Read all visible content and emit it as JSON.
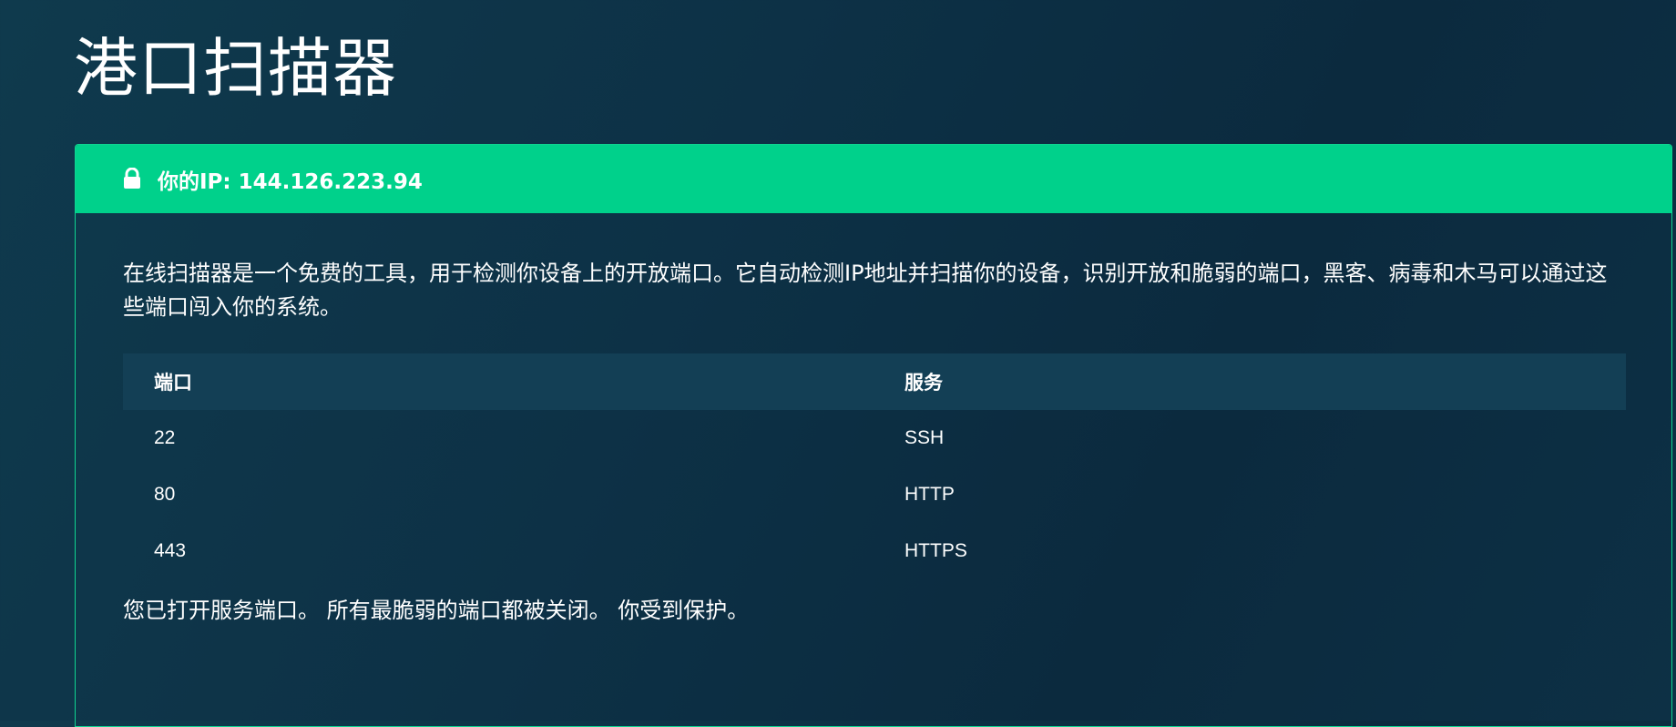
{
  "page": {
    "title": "港口扫描器"
  },
  "card": {
    "header": {
      "icon": "lock-icon",
      "ip_text": "你的IP: 144.126.223.94"
    },
    "description": "在线扫描器是一个免费的工具，用于检测你设备上的开放端口。它自动检测IP地址并扫描你的设备，识别开放和脆弱的端口，黑客、病毒和木马可以通过这些端口闯入你的系统。",
    "table": {
      "headers": [
        "端口",
        "服务"
      ],
      "rows": [
        [
          "22",
          "SSH"
        ],
        [
          "80",
          "HTTP"
        ],
        [
          "443",
          "HTTPS"
        ]
      ]
    },
    "status": "您已打开服务端口。 所有最脆弱的端口都被关闭。 你受到保护。"
  },
  "colors": {
    "accent": "#00d18b",
    "background": "#0d3146",
    "table_header": "#133f55"
  }
}
